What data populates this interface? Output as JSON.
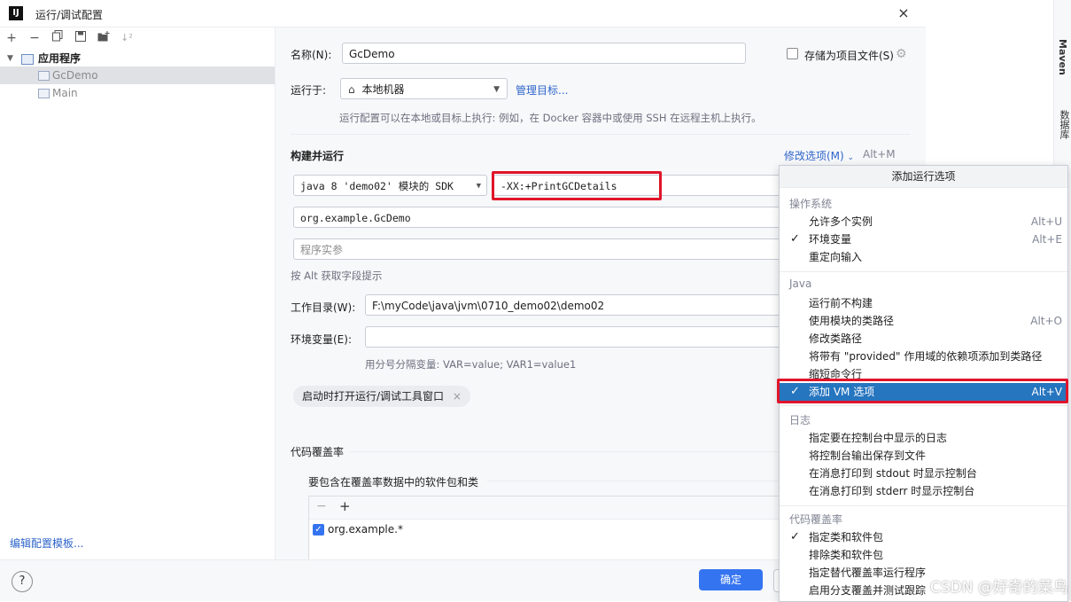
{
  "window": {
    "title": "运行/调试配置",
    "app_icon": "IJ",
    "close": "×"
  },
  "toolbar": {
    "icons": [
      "add-icon",
      "remove-icon",
      "copy-icon",
      "save-icon",
      "folder-add-icon",
      "sort-icon"
    ]
  },
  "tree": {
    "root": "应用程序",
    "items": [
      "GcDemo",
      "Main"
    ]
  },
  "left_footer": {
    "edit_templates": "编辑配置模板..."
  },
  "form": {
    "name_label": "名称(N):",
    "name_value": "GcDemo",
    "store_label": "存储为项目文件(S)",
    "run_on_label": "运行于:",
    "run_on_value": "本地机器",
    "manage_targets": "管理目标...",
    "run_on_hint": "运行配置可以在本地或目标上执行: 例如，在 Docker 容器中或使用 SSH 在远程主机上执行。",
    "build_run_header": "构建并运行",
    "modify_options": "修改选项(M)",
    "modify_shortcut": "Alt+M",
    "sdk_value": "java 8 'demo02' 模块的 SDK",
    "vm_options_value": "-XX:+PrintGCDetails",
    "main_class_value": "org.example.GcDemo",
    "program_args_placeholder": "程序实参",
    "alt_hint": "按 Alt 获取字段提示",
    "workdir_label": "工作目录(W):",
    "workdir_value": "F:\\myCode\\java\\jvm\\0710_demo02\\demo02",
    "env_label": "环境变量(E):",
    "env_hint": "用分号分隔变量: VAR=value; VAR1=value1",
    "open_tool_window_chip": "启动时打开运行/调试工具窗口",
    "coverage_header": "代码覆盖率",
    "coverage_include_label": "要包含在覆盖率数据中的软件包和类",
    "coverage_item": "org.example.*"
  },
  "buttons": {
    "help": "?",
    "ok": "确定"
  },
  "popup": {
    "title": "添加运行选项",
    "groups": [
      {
        "name": "操作系统",
        "items": [
          {
            "label": "允许多个实例",
            "shortcut": "Alt+U",
            "checked": false
          },
          {
            "label": "环境变量",
            "shortcut": "Alt+E",
            "checked": true
          },
          {
            "label": "重定向输入",
            "shortcut": "",
            "checked": false
          }
        ]
      },
      {
        "name": "Java",
        "items": [
          {
            "label": "运行前不构建",
            "shortcut": "",
            "checked": false
          },
          {
            "label": "使用模块的类路径",
            "shortcut": "Alt+O",
            "checked": false
          },
          {
            "label": "修改类路径",
            "shortcut": "",
            "checked": false
          },
          {
            "label": "将带有 \"provided\" 作用域的依赖项添加到类路径",
            "shortcut": "",
            "checked": false
          },
          {
            "label": "缩短命令行",
            "shortcut": "",
            "checked": false
          },
          {
            "label": "添加 VM 选项",
            "shortcut": "Alt+V",
            "checked": true,
            "selected": true
          }
        ]
      },
      {
        "name": "日志",
        "items": [
          {
            "label": "指定要在控制台中显示的日志",
            "shortcut": "",
            "checked": false
          },
          {
            "label": "将控制台输出保存到文件",
            "shortcut": "",
            "checked": false
          },
          {
            "label": "在消息打印到 stdout 时显示控制台",
            "shortcut": "",
            "checked": false
          },
          {
            "label": "在消息打印到 stderr 时显示控制台",
            "shortcut": "",
            "checked": false
          }
        ]
      },
      {
        "name": "代码覆盖率",
        "items": [
          {
            "label": "指定类和软件包",
            "shortcut": "",
            "checked": true
          },
          {
            "label": "排除类和软件包",
            "shortcut": "",
            "checked": false
          },
          {
            "label": "指定替代覆盖率运行程序",
            "shortcut": "",
            "checked": false
          },
          {
            "label": "启用分支覆盖并测试跟踪",
            "shortcut": "",
            "checked": false
          }
        ]
      }
    ]
  },
  "ide_strip": {
    "maven": "Maven",
    "database": "数据库"
  },
  "watermark": "CSDN @好奇的菜鸟",
  "colors": {
    "accent": "#3574f0",
    "selection": "#2675bf",
    "highlight_box": "#e0142a",
    "link": "#2f65ca"
  }
}
